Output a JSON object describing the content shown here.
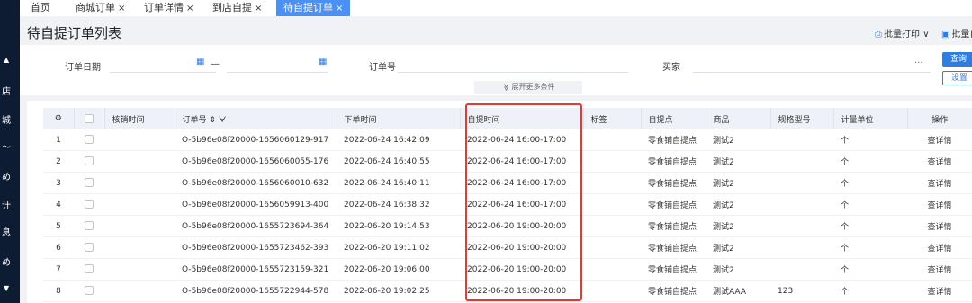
{
  "sidebar": {
    "glyphs": [
      "店",
      "城",
      "〜",
      "め",
      "计",
      "息",
      "め"
    ]
  },
  "tabs": [
    {
      "label": "首页",
      "closable": false,
      "active": false
    },
    {
      "label": "商城订单",
      "closable": true,
      "active": false
    },
    {
      "label": "订单详情",
      "closable": true,
      "active": false
    },
    {
      "label": "到店自提",
      "closable": true,
      "active": false
    },
    {
      "label": "待自提订单",
      "closable": true,
      "active": true
    }
  ],
  "close_glyph": "×",
  "header": {
    "title": "待自提订单列表",
    "batch_print": "批量打印",
    "batch_print_caret": "∨",
    "batch_more": "批量自"
  },
  "filters": {
    "order_date_label": "订单日期",
    "date_separator": "—",
    "order_no_label": "订单号",
    "buyer_label": "买家",
    "buyer_more": "···",
    "expand_label": "展开更多条件",
    "expand_icon": "≫",
    "query_button": "查询",
    "settings_button": "设置"
  },
  "table": {
    "columns": [
      "核销时间",
      "订单号",
      "下单时间",
      "自提时间",
      "标签",
      "自提点",
      "商品",
      "规格型号",
      "计量单位",
      "操作"
    ],
    "sort_icon": "⇕",
    "filter_icon": "ᗄ",
    "rows": [
      {
        "index": "1",
        "order_no": "O-5b96e08f20000-1656060129-917",
        "order_time": "2022-06-24 16:42:09",
        "pickup_time": "2022-06-24 16:00-17:00",
        "tag": "",
        "pickup_point": "零食铺自提点",
        "product": "测试2",
        "spec": "",
        "unit": "个",
        "action": "查详情"
      },
      {
        "index": "2",
        "order_no": "O-5b96e08f20000-1656060055-176",
        "order_time": "2022-06-24 16:40:55",
        "pickup_time": "2022-06-24 16:00-17:00",
        "tag": "",
        "pickup_point": "零食铺自提点",
        "product": "测试2",
        "spec": "",
        "unit": "个",
        "action": "查详情"
      },
      {
        "index": "3",
        "order_no": "O-5b96e08f20000-1656060010-632",
        "order_time": "2022-06-24 16:40:11",
        "pickup_time": "2022-06-24 16:00-17:00",
        "tag": "",
        "pickup_point": "零食铺自提点",
        "product": "测试2",
        "spec": "",
        "unit": "个",
        "action": "查详情"
      },
      {
        "index": "4",
        "order_no": "O-5b96e08f20000-1656059913-400",
        "order_time": "2022-06-24 16:38:32",
        "pickup_time": "2022-06-24 16:00-17:00",
        "tag": "",
        "pickup_point": "零食铺自提点",
        "product": "测试2",
        "spec": "",
        "unit": "个",
        "action": "查详情"
      },
      {
        "index": "5",
        "order_no": "O-5b96e08f20000-1655723694-364",
        "order_time": "2022-06-20 19:14:53",
        "pickup_time": "2022-06-20 19:00-20:00",
        "tag": "",
        "pickup_point": "零食铺自提点",
        "product": "测试2",
        "spec": "",
        "unit": "个",
        "action": "查详情"
      },
      {
        "index": "6",
        "order_no": "O-5b96e08f20000-1655723462-393",
        "order_time": "2022-06-20 19:11:02",
        "pickup_time": "2022-06-20 19:00-20:00",
        "tag": "",
        "pickup_point": "零食铺自提点",
        "product": "测试2",
        "spec": "",
        "unit": "个",
        "action": "查详情"
      },
      {
        "index": "7",
        "order_no": "O-5b96e08f20000-1655723159-321",
        "order_time": "2022-06-20 19:06:00",
        "pickup_time": "2022-06-20 19:00-20:00",
        "tag": "",
        "pickup_point": "零食铺自提点",
        "product": "测试2",
        "spec": "",
        "unit": "个",
        "action": "查详情"
      },
      {
        "index": "8",
        "order_no": "O-5b96e08f20000-1655722944-578",
        "order_time": "2022-06-20 19:02:25",
        "pickup_time": "2022-06-20 19:00-20:00",
        "tag": "",
        "pickup_point": "零食铺自提点",
        "product": "测试AAA",
        "spec": "123",
        "unit": "个",
        "action": "查详情"
      }
    ]
  },
  "colors": {
    "accent": "#2f7de1",
    "active_tab": "#4a90f5",
    "sidebar": "#0d1b33",
    "highlight": "#e53935"
  }
}
